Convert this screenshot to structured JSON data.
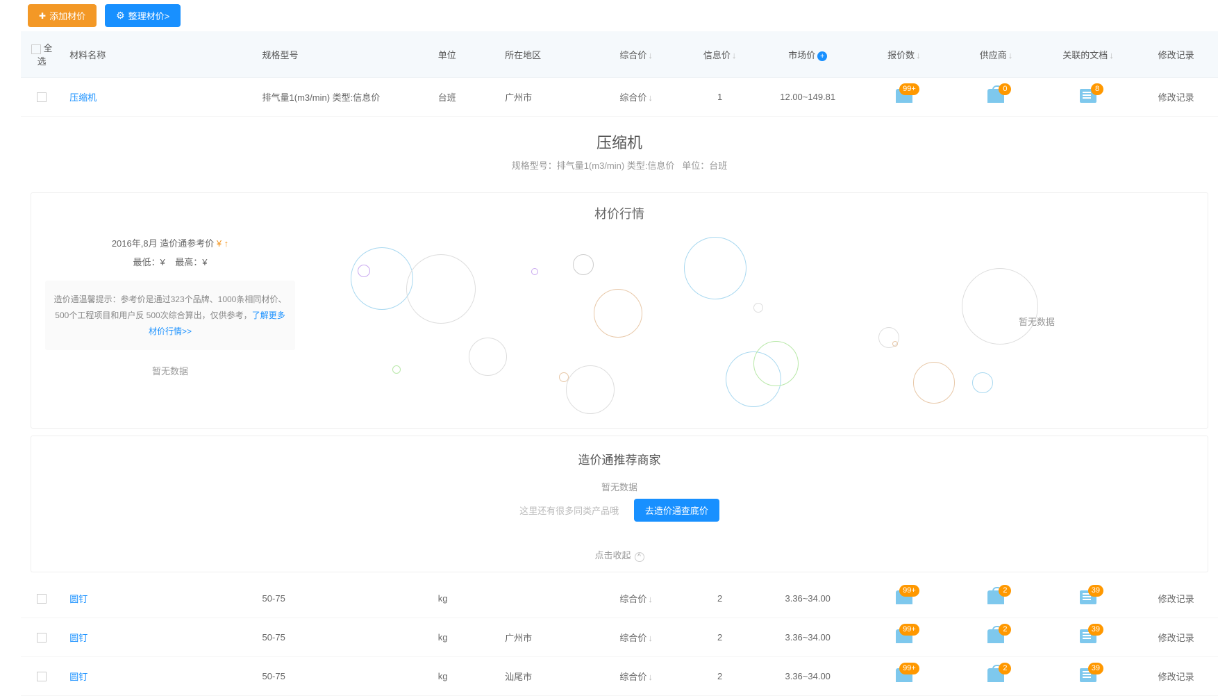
{
  "toolbar": {
    "add": "添加材价",
    "arrange": "整理材价>"
  },
  "headers": {
    "selectAll": "全选",
    "name": "材料名称",
    "spec": "规格型号",
    "unit": "单位",
    "area": "所在地区",
    "comp": "综合价",
    "info": "信息价",
    "market": "市场价",
    "quote": "报价数",
    "supplier": "供应商",
    "docs": "关联的文档",
    "modify": "修改记录"
  },
  "rows": [
    {
      "name": "压缩机",
      "spec": "排气量1(m3/min) 类型:信息价",
      "unit": "台班",
      "area": "广州市",
      "comp": "综合价",
      "info": "1",
      "market": "12.00~149.81",
      "quote": "99+",
      "supplier": "0",
      "docs": "8",
      "modify": "修改记录"
    }
  ],
  "detail": {
    "title": "压缩机",
    "subSpec": "规格型号：排气量1(m3/min) 类型:信息价",
    "subUnit": "单位：台班"
  },
  "marketCard": {
    "title": "材价行情",
    "refDate": "2016年,8月 造价通参考价",
    "low": "最低：¥",
    "high": "最高：¥",
    "hint1": "造价通温馨提示：参考价是通过323个品牌、1000条相同材价、500个工程项目和用户反 500次综合算出，仅供参考，",
    "hintLink": "了解更多材价行情>>",
    "nodata": "暂无数据"
  },
  "merchant": {
    "title": "造价通推荐商家",
    "nodata": "暂无数据",
    "grey": "这里还有很多同类产品哦",
    "btn": "去造价通查底价"
  },
  "collapse": "点击收起",
  "rows2": [
    {
      "name": "圆钉",
      "spec": "50-75",
      "unit": "kg",
      "area": "",
      "comp": "综合价",
      "info": "2",
      "market": "3.36~34.00",
      "quote": "99+",
      "supplier": "2",
      "docs": "39",
      "modify": "修改记录"
    },
    {
      "name": "圆钉",
      "spec": "50-75",
      "unit": "kg",
      "area": "广州市",
      "comp": "综合价",
      "info": "2",
      "market": "3.36~34.00",
      "quote": "99+",
      "supplier": "2",
      "docs": "39",
      "modify": "修改记录"
    },
    {
      "name": "圆钉",
      "spec": "50-75",
      "unit": "kg",
      "area": "汕尾市",
      "comp": "综合价",
      "info": "2",
      "market": "3.36~34.00",
      "quote": "99+",
      "supplier": "2",
      "docs": "39",
      "modify": "修改记录"
    }
  ]
}
